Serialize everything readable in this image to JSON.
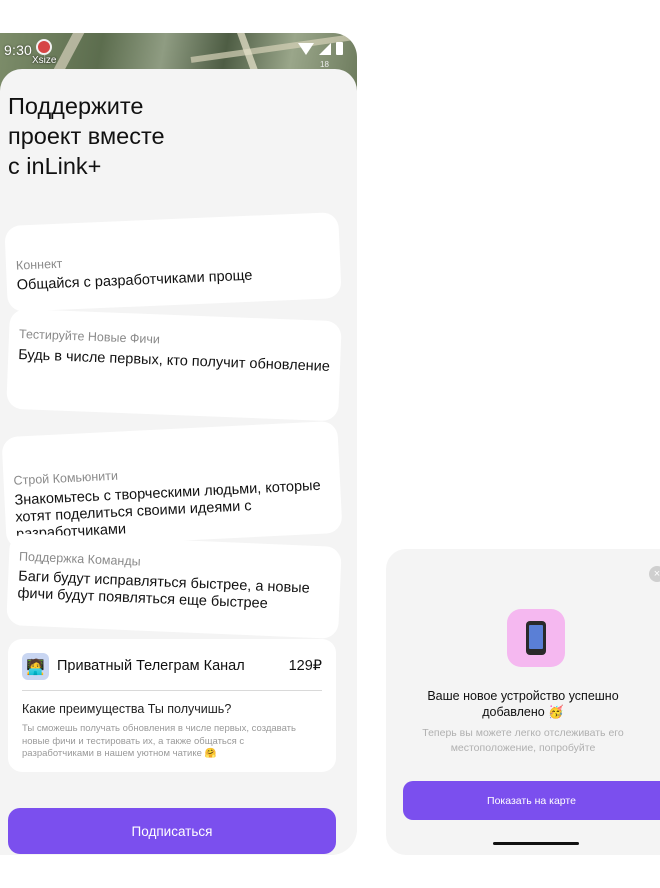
{
  "left_screen": {
    "status_bar": {
      "time": "9:30"
    },
    "map_labels": {
      "place": "Xsize",
      "corner": "18"
    },
    "title": "Поддержите\nпроект вместе\nс inLink+",
    "features": [
      {
        "label": "Коннект",
        "text": "Общайся с разработчиками проще"
      },
      {
        "label": "Тестируйте Новые Фичи",
        "text": "Будь в числе первых, кто получит обновление"
      },
      {
        "label": "Строй Комьюнити",
        "text": "Знакомьтесь с творческими людьми, которые хотят поделиться своими идеями с разработчиками"
      },
      {
        "label": "Поддержка Команды",
        "text": "Баги будут исправляться быстрее, а новые фичи будут появляться еще быстрее"
      }
    ],
    "plan": {
      "avatar_emoji": "🧑‍💻",
      "name": "Приватный Телеграм Канал",
      "price": "129₽",
      "question": "Какие преимущества Ты получишь?",
      "description": "Ты сможешь получать обновления в числе первых, создавать новые фичи и тестировать их, а также общаться с разработчиками в нашем уютном чатике 🤗"
    },
    "subscribe_label": "Подписаться"
  },
  "right_screen": {
    "close_glyph": "×",
    "success_title": "Ваше новое устройство успешно добавлено 🥳",
    "success_subtitle": "Теперь вы можете легко отслеживать его местоположение, попробуйте",
    "show_on_map_label": "Показать на карте"
  },
  "colors": {
    "accent": "#7b4fee",
    "background": "#f4f4f4",
    "card": "#ffffff",
    "device_tile": "#f5b8f0"
  }
}
